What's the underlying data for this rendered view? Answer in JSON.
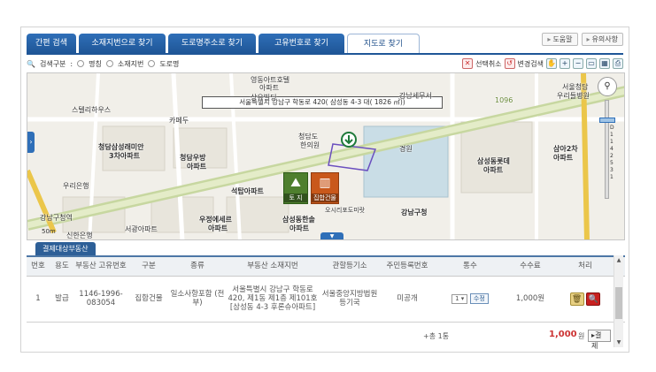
{
  "tabs": [
    {
      "label": "간편 검색",
      "active": false
    },
    {
      "label": "소재지번으로 찾기",
      "active": false
    },
    {
      "label": "도로명주소로 찾기",
      "active": false
    },
    {
      "label": "고유번호로 찾기",
      "active": false
    },
    {
      "label": "지도로 찾기",
      "active": true
    }
  ],
  "top_buttons": {
    "help": "도움말",
    "notice": "유의사항"
  },
  "search": {
    "label": "검색구분",
    "options": [
      "명칭",
      "소재지번",
      "도로명"
    ]
  },
  "map_tools": {
    "clear": "선택취소",
    "change": "변경검색"
  },
  "map": {
    "address_box": "서울특별시 강남구 학동로 420( 삼성동 4-3 대( 1826 ㎡))",
    "labels": [
      "영동아트호텔",
      "아파트",
      "상유빌딩",
      "강남세무서",
      "서울청담",
      "우리들병원",
      "스텔리하우스",
      "카페두",
      "청담삼성래미안",
      "3차아파트",
      "청담우방",
      "아파트",
      "청담도",
      "한의원",
      "경원",
      "삼성동롯데",
      "아파트",
      "삼아2차",
      "아파트",
      "우리은행",
      "석탑아파트",
      "오시리포도미랏",
      "강남구청",
      "우정에세르",
      "아파트",
      "삼성동한솔",
      "아파트",
      "신한은행",
      "서광아파트",
      "강남구청역",
      "1096"
    ],
    "land_button": "토 지",
    "building_button": "집합건물",
    "scale": "50m",
    "zoom_level_text": "D 1 1 4 2 5 3 1"
  },
  "section_tab": "결제대상부동산",
  "table": {
    "headers": [
      "번호",
      "용도",
      "부동산 고유번호",
      "구분",
      "종류",
      "부동산 소재지번",
      "관할등기소",
      "주민등록번호",
      "통수",
      "수수료",
      "처리"
    ],
    "rows": [
      {
        "no": "1",
        "use": "발급",
        "id": "1146-1996-083054",
        "type": "집합건물",
        "kind": "일소사항포함 (전부)",
        "address": "서울특별시 강남구 학동로 420, 제1동 제1층 제101호 [삼성동 4-3 후론슈아파트]",
        "office": "서울중앙지방법원 등기국",
        "resident": "미공개",
        "count": "1",
        "edit": "수정",
        "fee": "1,000원"
      }
    ]
  },
  "footer": {
    "count": "+총 1통",
    "total": "1,000",
    "unit": "원",
    "pay": "결제"
  },
  "colors": {
    "tab_blue": "#1f5697",
    "accent_red": "#c33333",
    "land_green": "#4e7f2e",
    "building_orange": "#c9581b"
  }
}
